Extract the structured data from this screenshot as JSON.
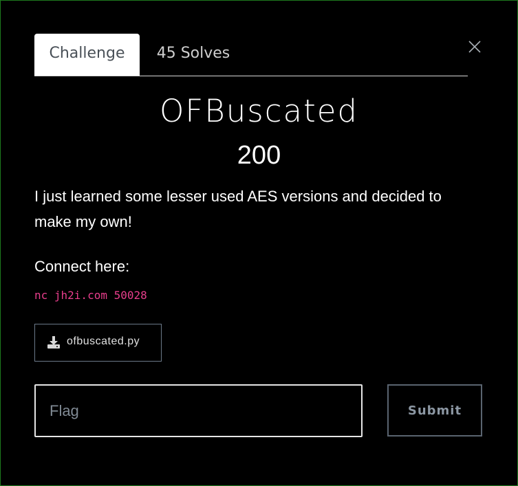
{
  "tabs": [
    {
      "label": "Challenge",
      "active": true
    },
    {
      "label": "45 Solves",
      "active": false
    }
  ],
  "challenge": {
    "name": "OFBuscated",
    "points": "200",
    "description": "I just learned some lesser used AES versions and decided to make my own!",
    "connect_label": "Connect here:",
    "connect_command": "nc jh2i.com 50028"
  },
  "files": [
    {
      "name": "ofbuscated.py",
      "icon": "download-icon"
    }
  ],
  "form": {
    "flag_placeholder": "Flag",
    "flag_value": "",
    "submit_label": "Submit"
  },
  "colors": {
    "background": "#000000",
    "modal_border": "#1e7a1e",
    "code_text": "#e83e8c",
    "active_tab_bg": "#ffffff"
  }
}
